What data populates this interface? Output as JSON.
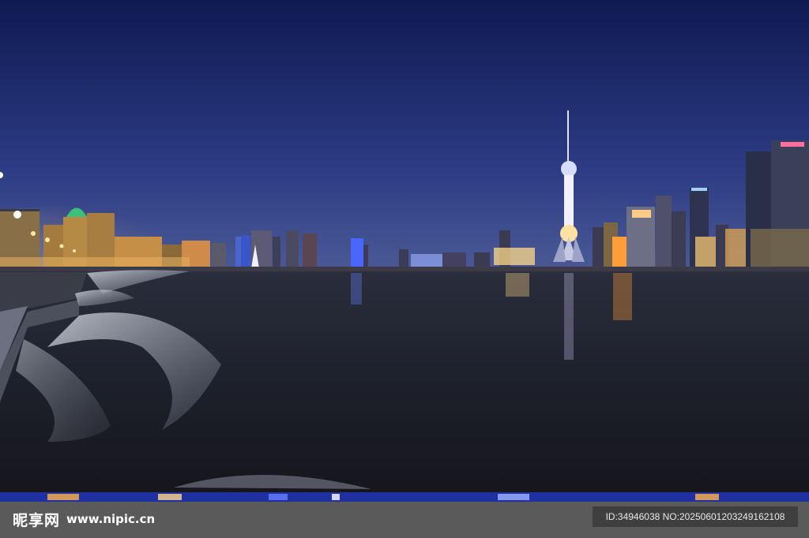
{
  "photo": {
    "subject": "Shanghai Bund night skyline across the Huangpu River",
    "colors": {
      "sky_top": "#1b2a6e",
      "sky_horizon": "#4a5b9a",
      "water": "#1b1f2a",
      "city_glow": "#ffb44a"
    }
  },
  "watermark": {
    "site_name": "昵享网",
    "url": "www.nipic.cn",
    "id_text": "ID:34946038 NO:20250601203249162108"
  }
}
